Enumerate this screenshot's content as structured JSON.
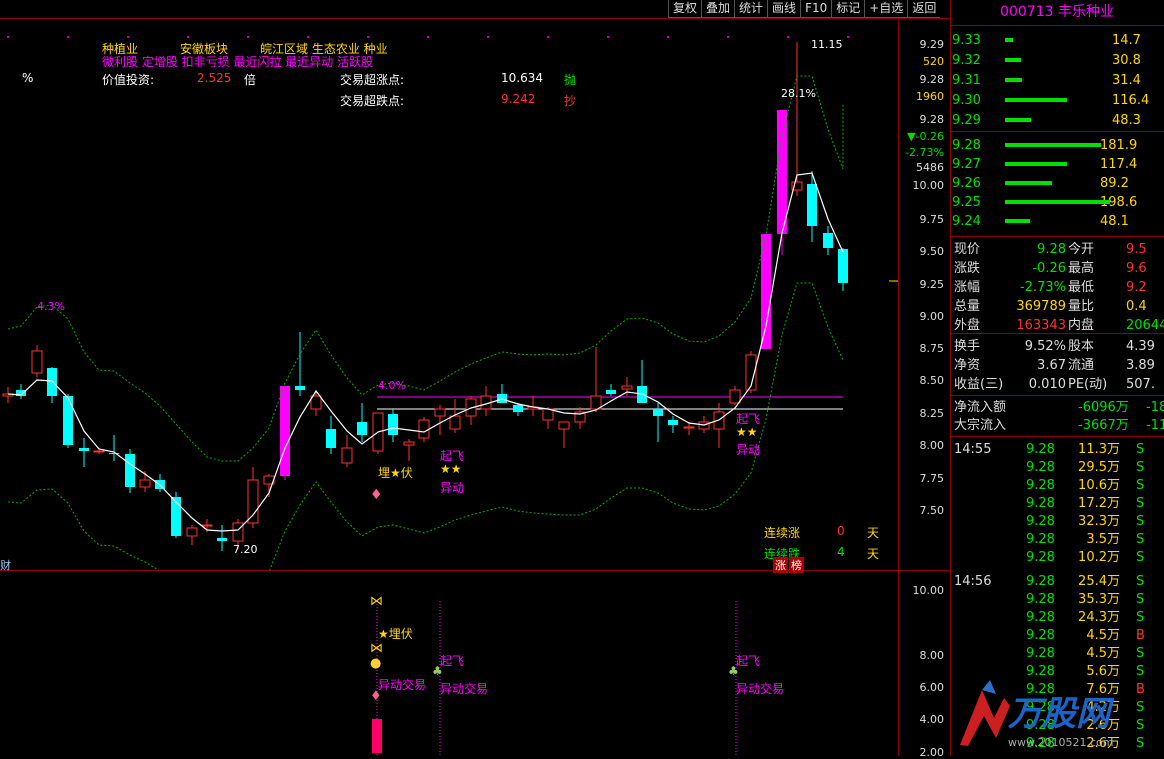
{
  "toolbar": [
    "复权",
    "叠加",
    "统计",
    "画线",
    "F10",
    "标记",
    "+自选",
    "返回"
  ],
  "info": {
    "line1": [
      "种植业",
      "安徽板块",
      "皖江区域 生态农业 种业"
    ],
    "line2": "微利股 定增股 扣非亏损 最近闪拉 最近异动 活跃股",
    "pct_label": "%",
    "value_label": "价值投资:",
    "value": "2.525",
    "value_unit": "倍",
    "surge_label": "交易超涨点:",
    "surge_value": "10.634",
    "surge_action": "抛",
    "drop_label": "交易超跌点:",
    "drop_value": "9.242",
    "drop_action": "抄"
  },
  "chart": {
    "annot_high": "11.15",
    "annot_pct": "28.1%",
    "annot_low": "7.20",
    "band_pct_left": "4.3%",
    "band_pct_mid": "4.0%",
    "tag_maifu": "埋★伏",
    "tag_qifei": "起飞",
    "tag_stars": "★★",
    "tag_yidong": "异动",
    "streak_up_label": "连续涨",
    "streak_up_val": "0",
    "streak_down_label": "连续跌",
    "streak_down_val": "4",
    "day_unit": "天",
    "badge_zhang": "涨",
    "badge_bang": "榜",
    "left_edge": "财"
  },
  "price_axis": {
    "ticks": [
      "9.29",
      "520",
      "9.28",
      "1960",
      "9.28",
      "▼-0.26",
      "-2.73%",
      "5486",
      "10.00",
      "9.75",
      "9.50",
      "9.25",
      "9.00",
      "8.75",
      "8.50",
      "8.25",
      "8.00",
      "7.75",
      "7.50"
    ]
  },
  "sub_axis": {
    "ticks": [
      "10.00",
      "8.00",
      "6.00",
      "4.00",
      "2.00"
    ]
  },
  "sub": {
    "maifu": "★埋伏",
    "yidong1": "异动交易",
    "qifei1": "起飞",
    "yidong2": "异动交易",
    "qifei2": "起飞",
    "yidong3": "异动交易"
  },
  "stock": {
    "code": "000713",
    "name": "丰乐种业"
  },
  "asks": [
    {
      "price": "9.33",
      "vol": "14.7"
    },
    {
      "price": "9.32",
      "vol": "30.8"
    },
    {
      "price": "9.31",
      "vol": "31.4"
    },
    {
      "price": "9.30",
      "vol": "116.4"
    },
    {
      "price": "9.29",
      "vol": "48.3"
    }
  ],
  "bids": [
    {
      "price": "9.28",
      "vol": "181.9"
    },
    {
      "price": "9.27",
      "vol": "117.4"
    },
    {
      "price": "9.26",
      "vol": "89.2"
    },
    {
      "price": "9.25",
      "vol": "198.6"
    },
    {
      "price": "9.24",
      "vol": "48.1"
    }
  ],
  "quote": [
    {
      "l1": "现价",
      "v1": "9.28",
      "l2": "今开",
      "v2": "9.5"
    },
    {
      "l1": "涨跌",
      "v1": "-0.26",
      "l2": "最高",
      "v2": "9.6"
    },
    {
      "l1": "涨幅",
      "v1": "-2.73%",
      "l2": "最低",
      "v2": "9.2"
    },
    {
      "l1": "总量",
      "v1": "369789",
      "l2": "量比",
      "v2": "0.4"
    },
    {
      "l1": "外盘",
      "v1": "163343",
      "l2": "内盘",
      "v2": "20644"
    }
  ],
  "quote2": [
    {
      "l1": "换手",
      "v1": "9.52%",
      "l2": "股本",
      "v2": "4.39"
    },
    {
      "l1": "净资",
      "v1": "3.67",
      "l2": "流通",
      "v2": "3.89"
    },
    {
      "l1": "收益(三)",
      "v1": "0.010",
      "l2": "PE(动)",
      "v2": "507."
    }
  ],
  "flows": [
    {
      "label": "净流入额",
      "v1": "-6096万",
      "v2": "-18"
    },
    {
      "label": "大宗流入",
      "v1": "-3667万",
      "v2": "-11"
    }
  ],
  "ticks": [
    {
      "time": "14:55",
      "price": "9.28",
      "vol": "11.3万",
      "bs": "S"
    },
    {
      "time": "",
      "price": "9.28",
      "vol": "29.5万",
      "bs": "S"
    },
    {
      "time": "",
      "price": "9.28",
      "vol": "10.6万",
      "bs": "S"
    },
    {
      "time": "",
      "price": "9.28",
      "vol": "17.2万",
      "bs": "S"
    },
    {
      "time": "",
      "price": "9.28",
      "vol": "32.3万",
      "bs": "S"
    },
    {
      "time": "",
      "price": "9.28",
      "vol": "3.5万",
      "bs": "S"
    },
    {
      "time": "",
      "price": "9.28",
      "vol": "10.2万",
      "bs": "S"
    },
    {
      "time": "14:56",
      "price": "9.28",
      "vol": "25.4万",
      "bs": "S"
    },
    {
      "time": "",
      "price": "9.28",
      "vol": "35.3万",
      "bs": "S"
    },
    {
      "time": "",
      "price": "9.28",
      "vol": "24.3万",
      "bs": "S"
    },
    {
      "time": "",
      "price": "9.28",
      "vol": "4.5万",
      "bs": "B"
    },
    {
      "time": "",
      "price": "9.28",
      "vol": "4.5万",
      "bs": "S"
    },
    {
      "time": "",
      "price": "9.28",
      "vol": "5.6万",
      "bs": "S"
    },
    {
      "time": "",
      "price": "9.28",
      "vol": "7.6万",
      "bs": "B"
    },
    {
      "time": "",
      "price": "9.28",
      "vol": "4.2万",
      "bs": "S"
    },
    {
      "time": "",
      "price": "9.28",
      "vol": "2.6万",
      "bs": "S"
    },
    {
      "time": "",
      "price": "9.28",
      "vol": "2.6万",
      "bs": "S"
    }
  ],
  "watermark": {
    "logo": "万股网",
    "url": "www.2010521.com"
  },
  "colors": {
    "up": "#ff3030",
    "down": "#00ffff",
    "limit": "#ff00ff",
    "band": "#00b000",
    "ma": "#ffffff"
  }
}
